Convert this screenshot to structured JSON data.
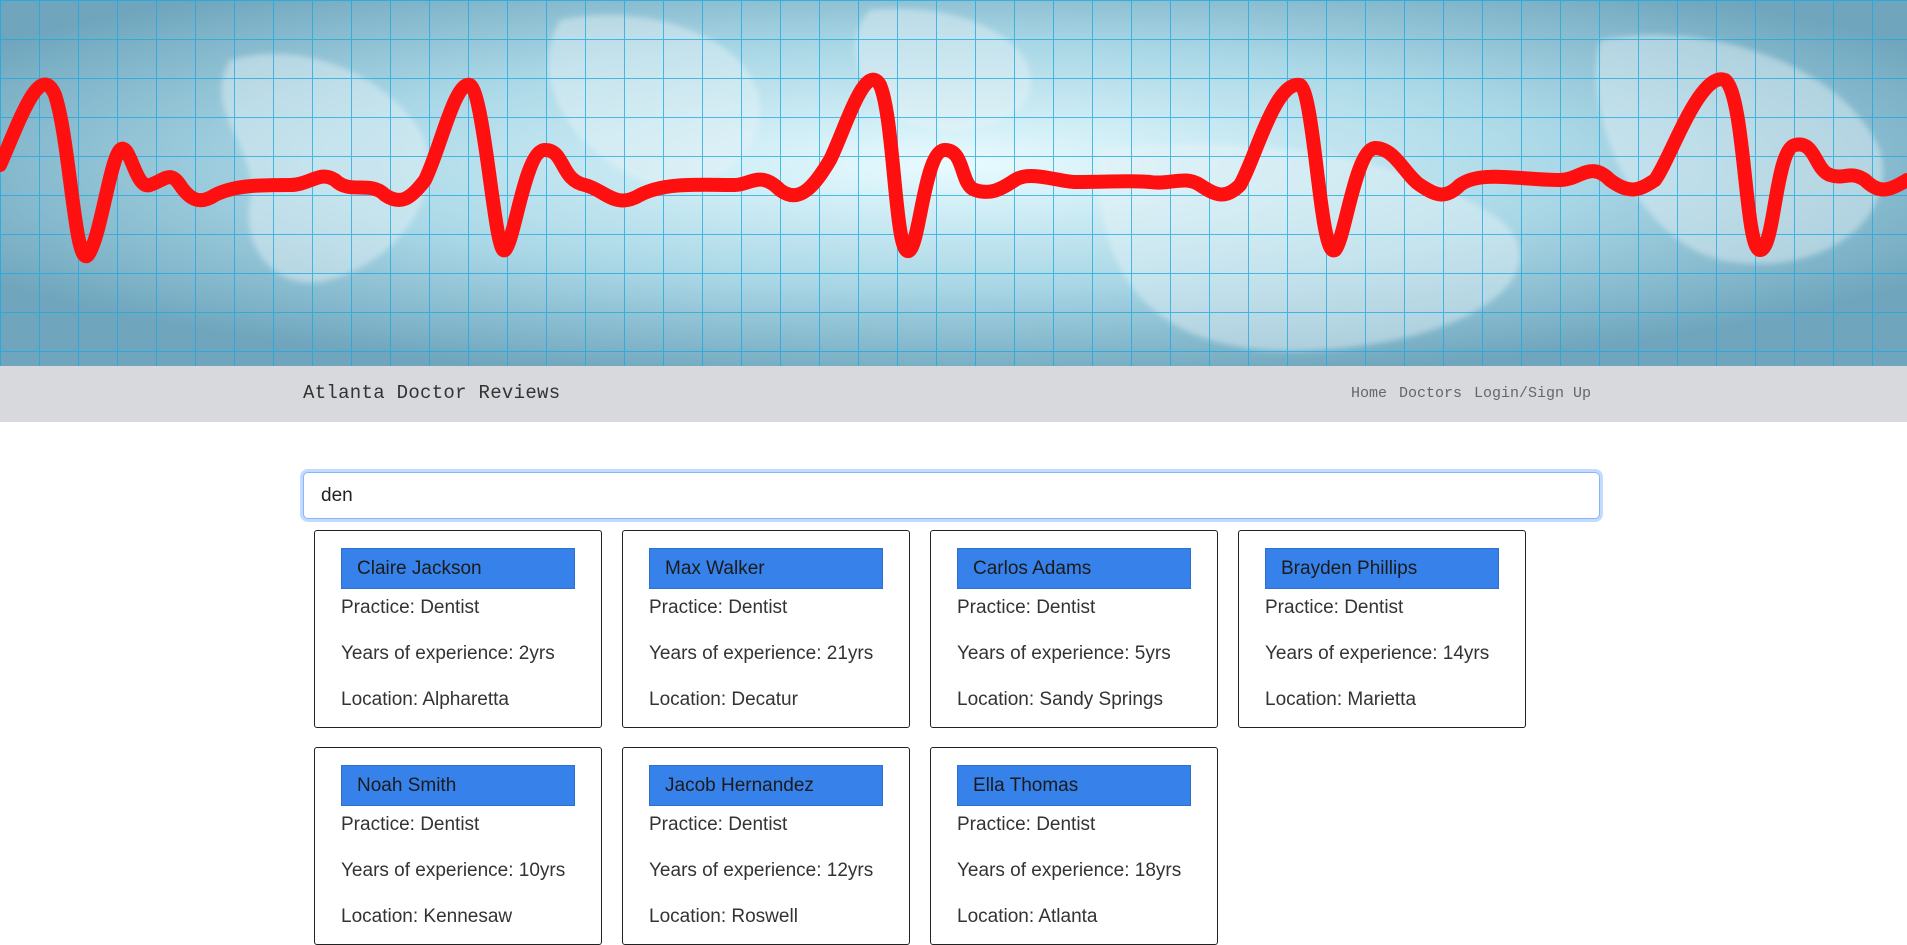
{
  "navbar": {
    "brand": "Atlanta Doctor Reviews",
    "links": [
      "Home",
      "Doctors",
      "Login/Sign Up"
    ]
  },
  "search": {
    "value": "den"
  },
  "doctors": [
    {
      "name": "Claire Jackson",
      "practice": "Practice: Dentist",
      "experience": "Years of experience: 2yrs",
      "location": "Location: Alpharetta"
    },
    {
      "name": "Max Walker",
      "practice": "Practice: Dentist",
      "experience": "Years of experience: 21yrs",
      "location": "Location: Decatur"
    },
    {
      "name": "Carlos Adams",
      "practice": "Practice: Dentist",
      "experience": "Years of experience: 5yrs",
      "location": "Location: Sandy Springs"
    },
    {
      "name": "Brayden Phillips",
      "practice": "Practice: Dentist",
      "experience": "Years of experience: 14yrs",
      "location": "Location: Marietta"
    },
    {
      "name": "Noah Smith",
      "practice": "Practice: Dentist",
      "experience": "Years of experience: 10yrs",
      "location": "Location: Kennesaw"
    },
    {
      "name": "Jacob Hernandez",
      "practice": "Practice: Dentist",
      "experience": "Years of experience: 12yrs",
      "location": "Location: Roswell"
    },
    {
      "name": "Ella Thomas",
      "practice": "Practice: Dentist",
      "experience": "Years of experience: 18yrs",
      "location": "Location: Atlanta"
    }
  ],
  "colors": {
    "banner_line": "#ff1010",
    "card_header": "#3781ea",
    "navbar_bg": "#d8d9dd"
  }
}
